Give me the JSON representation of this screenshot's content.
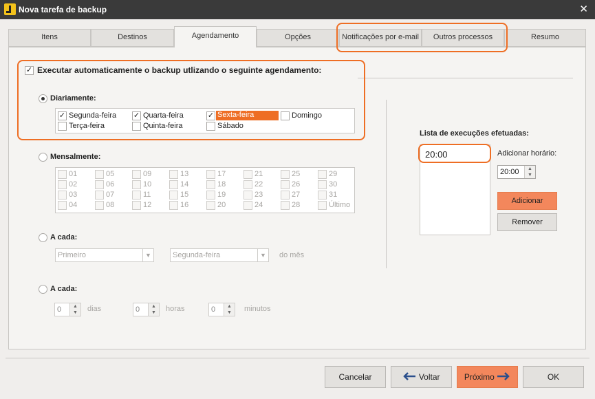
{
  "window": {
    "title": "Nova tarefa de backup"
  },
  "tabs": [
    {
      "label": "Itens"
    },
    {
      "label": "Destinos"
    },
    {
      "label": "Agendamento"
    },
    {
      "label": "Opções"
    },
    {
      "label": "Notificações por e-mail"
    },
    {
      "label": "Outros processos"
    },
    {
      "label": "Resumo"
    }
  ],
  "schedule": {
    "auto_label": "Executar automaticamente o backup utlizando o seguinte agendamento:",
    "auto_checked": true,
    "daily": {
      "label": "Diariamente:",
      "selected": true,
      "days": [
        {
          "label": "Segunda-feira",
          "checked": true
        },
        {
          "label": "Quarta-feira",
          "checked": true
        },
        {
          "label": "Sexta-feira",
          "checked": true
        },
        {
          "label": "Domingo",
          "checked": false
        },
        {
          "label": "Terça-feira",
          "checked": false
        },
        {
          "label": "Quinta-feira",
          "checked": false
        },
        {
          "label": "Sábado",
          "checked": false
        }
      ]
    },
    "monthly": {
      "label": "Mensalmente:",
      "days": [
        "01",
        "02",
        "03",
        "04",
        "05",
        "06",
        "07",
        "08",
        "09",
        "10",
        "11",
        "12",
        "13",
        "14",
        "15",
        "16",
        "17",
        "18",
        "19",
        "20",
        "21",
        "22",
        "23",
        "24",
        "25",
        "26",
        "27",
        "28",
        "29",
        "30",
        "31",
        "Último"
      ]
    },
    "every1": {
      "label": "A cada:",
      "first_combo": "Primeiro",
      "second_combo": "Segunda-feira",
      "suffix": "do mês"
    },
    "every2": {
      "label": "A cada:",
      "days_value": "0",
      "days_label": "dias",
      "hours_value": "0",
      "hours_label": "horas",
      "minutes_value": "0",
      "minutes_label": "minutos"
    },
    "executions": {
      "title": "Lista de execuções efetuadas:",
      "items": [
        "20:00"
      ],
      "add_time_label": "Adicionar horário:",
      "add_time_value": "20:00",
      "add_button": "Adicionar",
      "remove_button": "Remover"
    }
  },
  "footer": {
    "cancel": "Cancelar",
    "back": "Voltar",
    "next": "Próximo",
    "ok": "OK"
  },
  "colors": {
    "accent": "#ee6e24",
    "titlebar": "#3a3a3a"
  }
}
